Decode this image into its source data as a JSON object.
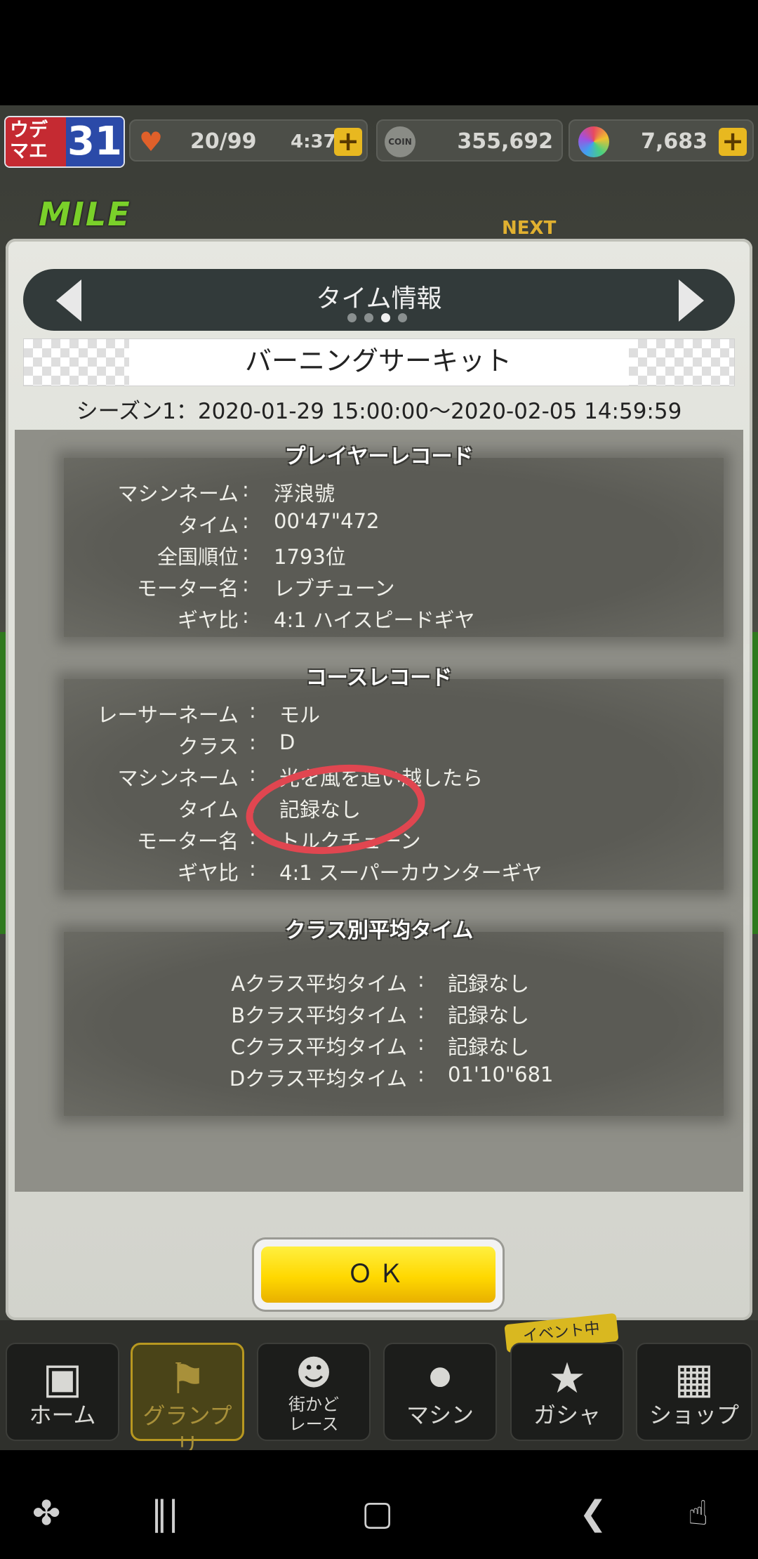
{
  "header": {
    "rank_label": "ウデマエ",
    "rank_value": "31",
    "stamina": "20/99",
    "stamina_timer": "4:37",
    "coins": "355,692",
    "coin_icon_text": "COIN",
    "gems": "7,683",
    "plus_glyph": "+"
  },
  "background": {
    "logo": "MILE",
    "next_label": "NEXT"
  },
  "dialog": {
    "title": "タイム情報",
    "page_indicator": {
      "count": 4,
      "active": 3
    },
    "course_name": "バーニングサーキット",
    "season": "シーズン1：2020-01-29 15:00:00〜2020-02-05 14:59:59",
    "sections": {
      "player": {
        "title": "プレイヤーレコード",
        "rows": [
          {
            "label": "マシンネーム",
            "value": "浮浪號"
          },
          {
            "label": "タイム",
            "value": "00'47\"472"
          },
          {
            "label": "全国順位",
            "value": "1793位"
          },
          {
            "label": "モーター名",
            "value": "レブチューン"
          },
          {
            "label": "ギヤ比",
            "value": "4:1 ハイスピードギヤ"
          }
        ]
      },
      "course": {
        "title": "コースレコード",
        "rows": [
          {
            "label": "レーサーネーム",
            "value": "モル"
          },
          {
            "label": "クラス",
            "value": "D"
          },
          {
            "label": "マシンネーム",
            "value": "光を風を追い越したら"
          },
          {
            "label": "タイム",
            "value": "記録なし"
          },
          {
            "label": "モーター名",
            "value": "トルクチューン"
          },
          {
            "label": "ギヤ比",
            "value": "4:1 スーパーカウンターギヤ"
          }
        ]
      },
      "class_avg": {
        "title": "クラス別平均タイム",
        "rows": [
          {
            "label": "Aクラス平均タイム",
            "value": "記録なし"
          },
          {
            "label": "Bクラス平均タイム",
            "value": "記録なし"
          },
          {
            "label": "Cクラス平均タイム",
            "value": "記録なし"
          },
          {
            "label": "Dクラス平均タイム",
            "value": "01'10\"681"
          }
        ]
      }
    },
    "separator": ":",
    "ok_label": "ＯＫ"
  },
  "nav": {
    "items": [
      {
        "label": "ホーム",
        "icon": "toolbox-icon"
      },
      {
        "label": "グランプリ",
        "icon": "checkered-flag-icon",
        "active": true
      },
      {
        "label": "街かど\nレース",
        "icon": "people-icon"
      },
      {
        "label": "マシン",
        "icon": "car-icon"
      },
      {
        "label": "ガシャ",
        "icon": "star-laurel-icon"
      },
      {
        "label": "ショップ",
        "icon": "building-icon"
      }
    ],
    "event_tag": "イベント中"
  },
  "colors": {
    "ok_button": "#ffd800",
    "annotation": "#e04650",
    "active_nav": "#b89820"
  }
}
